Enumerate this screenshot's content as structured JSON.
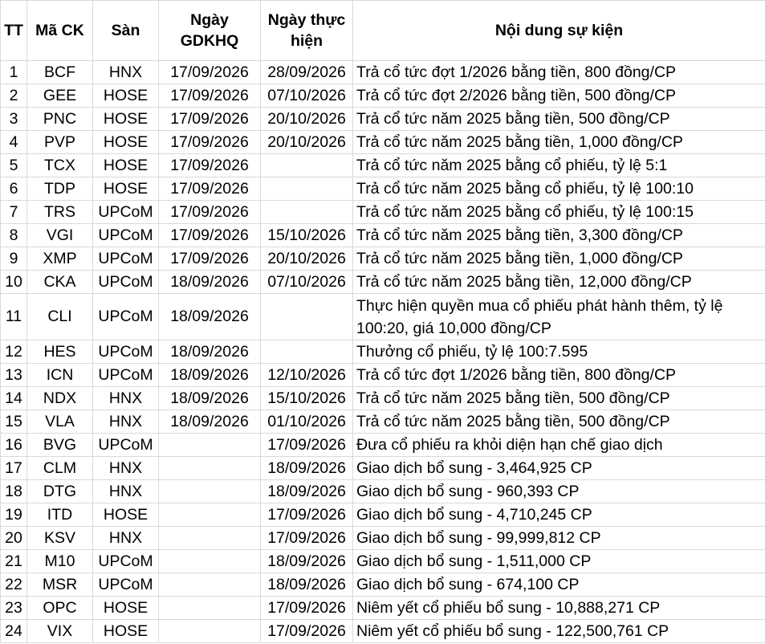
{
  "header": {
    "tt": "TT",
    "ma": "Mã CK",
    "san": "Sàn",
    "gdkhq": "Ngày GDKHQ",
    "thuchien": "Ngày thực hiện",
    "noidung": "Nội dung sự kiện"
  },
  "rows": [
    {
      "tt": "1",
      "ma": "BCF",
      "san": "HNX",
      "gdkhq": "17/09/2026",
      "thuchien": "28/09/2026",
      "noidung": "Trả cổ tức đợt 1/2026 bằng tiền, 800 đồng/CP"
    },
    {
      "tt": "2",
      "ma": "GEE",
      "san": "HOSE",
      "gdkhq": "17/09/2026",
      "thuchien": "07/10/2026",
      "noidung": "Trả cổ tức đợt 2/2026 bằng tiền, 500 đồng/CP"
    },
    {
      "tt": "3",
      "ma": "PNC",
      "san": "HOSE",
      "gdkhq": "17/09/2026",
      "thuchien": "20/10/2026",
      "noidung": "Trả cổ tức năm 2025 bằng tiền, 500 đồng/CP"
    },
    {
      "tt": "4",
      "ma": "PVP",
      "san": "HOSE",
      "gdkhq": "17/09/2026",
      "thuchien": "20/10/2026",
      "noidung": "Trả cổ tức năm 2025 bằng tiền, 1,000 đồng/CP"
    },
    {
      "tt": "5",
      "ma": "TCX",
      "san": "HOSE",
      "gdkhq": "17/09/2026",
      "thuchien": "",
      "noidung": "Trả cổ tức năm 2025 bằng cổ phiếu, tỷ lệ 5:1"
    },
    {
      "tt": "6",
      "ma": "TDP",
      "san": "HOSE",
      "gdkhq": "17/09/2026",
      "thuchien": "",
      "noidung": "Trả cổ tức năm 2025 bằng cổ phiếu, tỷ lệ 100:10"
    },
    {
      "tt": "7",
      "ma": "TRS",
      "san": "UPCoM",
      "gdkhq": "17/09/2026",
      "thuchien": "",
      "noidung": "Trả cổ tức năm 2025 bằng cổ phiếu, tỷ lệ 100:15"
    },
    {
      "tt": "8",
      "ma": "VGI",
      "san": "UPCoM",
      "gdkhq": "17/09/2026",
      "thuchien": "15/10/2026",
      "noidung": "Trả cổ tức năm 2025 bằng tiền, 3,300 đồng/CP"
    },
    {
      "tt": "9",
      "ma": "XMP",
      "san": "UPCoM",
      "gdkhq": "17/09/2026",
      "thuchien": "20/10/2026",
      "noidung": "Trả cổ tức năm 2025 bằng tiền, 1,000 đồng/CP"
    },
    {
      "tt": "10",
      "ma": "CKA",
      "san": "UPCoM",
      "gdkhq": "18/09/2026",
      "thuchien": "07/10/2026",
      "noidung": "Trả cổ tức năm 2025 bằng tiền, 12,000 đồng/CP"
    },
    {
      "tt": "11",
      "ma": "CLI",
      "san": "UPCoM",
      "gdkhq": "18/09/2026",
      "thuchien": "",
      "noidung": "Thực hiện quyền mua cổ phiếu phát hành thêm, tỷ lệ 100:20, giá 10,000 đồng/CP"
    },
    {
      "tt": "12",
      "ma": "HES",
      "san": "UPCoM",
      "gdkhq": "18/09/2026",
      "thuchien": "",
      "noidung": "Thưởng cổ phiếu, tỷ lệ 100:7.595"
    },
    {
      "tt": "13",
      "ma": "ICN",
      "san": "UPCoM",
      "gdkhq": "18/09/2026",
      "thuchien": "12/10/2026",
      "noidung": "Trả cổ tức đợt 1/2026 bằng tiền, 800 đồng/CP"
    },
    {
      "tt": "14",
      "ma": "NDX",
      "san": "HNX",
      "gdkhq": "18/09/2026",
      "thuchien": "15/10/2026",
      "noidung": "Trả cổ tức năm 2025 bằng tiền, 500 đồng/CP"
    },
    {
      "tt": "15",
      "ma": "VLA",
      "san": "HNX",
      "gdkhq": "18/09/2026",
      "thuchien": "01/10/2026",
      "noidung": "Trả cổ tức năm 2025 bằng tiền, 500 đồng/CP"
    },
    {
      "tt": "16",
      "ma": "BVG",
      "san": "UPCoM",
      "gdkhq": "",
      "thuchien": "17/09/2026",
      "noidung": "Đưa cổ phiếu ra khỏi diện hạn chế giao dịch"
    },
    {
      "tt": "17",
      "ma": "CLM",
      "san": "HNX",
      "gdkhq": "",
      "thuchien": "18/09/2026",
      "noidung": "Giao dịch bổ sung - 3,464,925 CP"
    },
    {
      "tt": "18",
      "ma": "DTG",
      "san": "HNX",
      "gdkhq": "",
      "thuchien": "18/09/2026",
      "noidung": "Giao dịch bổ sung - 960,393 CP"
    },
    {
      "tt": "19",
      "ma": "ITD",
      "san": "HOSE",
      "gdkhq": "",
      "thuchien": "17/09/2026",
      "noidung": "Giao dịch bổ sung - 4,710,245 CP"
    },
    {
      "tt": "20",
      "ma": "KSV",
      "san": "HNX",
      "gdkhq": "",
      "thuchien": "17/09/2026",
      "noidung": "Giao dịch bổ sung - 99,999,812 CP"
    },
    {
      "tt": "21",
      "ma": "M10",
      "san": "UPCoM",
      "gdkhq": "",
      "thuchien": "18/09/2026",
      "noidung": "Giao dịch bổ sung - 1,511,000 CP"
    },
    {
      "tt": "22",
      "ma": "MSR",
      "san": "UPCoM",
      "gdkhq": "",
      "thuchien": "18/09/2026",
      "noidung": "Giao dịch bổ sung - 674,100 CP"
    },
    {
      "tt": "23",
      "ma": "OPC",
      "san": "HOSE",
      "gdkhq": "",
      "thuchien": "17/09/2026",
      "noidung": "Niêm yết cổ phiếu bổ sung - 10,888,271 CP"
    },
    {
      "tt": "24",
      "ma": "VIX",
      "san": "HOSE",
      "gdkhq": "",
      "thuchien": "17/09/2026",
      "noidung": "Niêm yết cổ phiếu bổ sung - 122,500,761 CP"
    }
  ]
}
